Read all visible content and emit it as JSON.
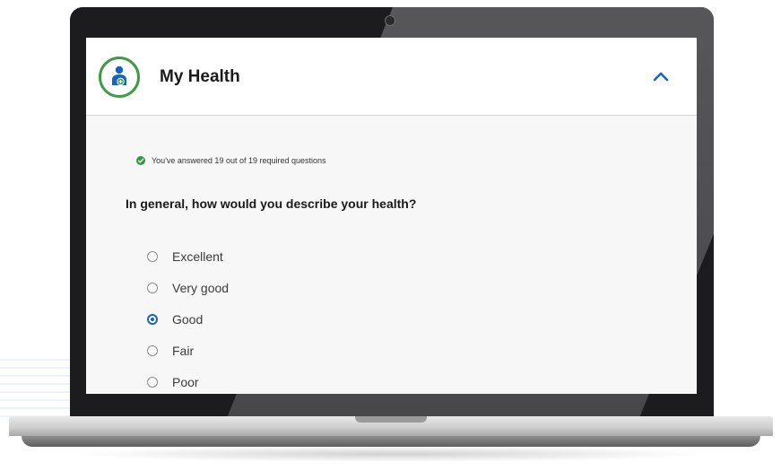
{
  "header": {
    "title": "My Health",
    "avatar_icon": "patient-icon",
    "collapse_icon": "chevron-up-icon"
  },
  "progress": {
    "text": "You've answered 19 out of 19 required questions",
    "answered": 19,
    "required": 19,
    "icon": "check-circle-icon"
  },
  "question": {
    "text": "In general, how would you describe your health?",
    "options": [
      {
        "label": "Excellent",
        "selected": false
      },
      {
        "label": "Very good",
        "selected": false
      },
      {
        "label": "Good",
        "selected": true
      },
      {
        "label": "Fair",
        "selected": false
      },
      {
        "label": "Poor",
        "selected": false
      }
    ]
  },
  "colors": {
    "accent": "#1565c0",
    "success": "#2f9a3f",
    "avatar_ring": "#3f9b45"
  }
}
